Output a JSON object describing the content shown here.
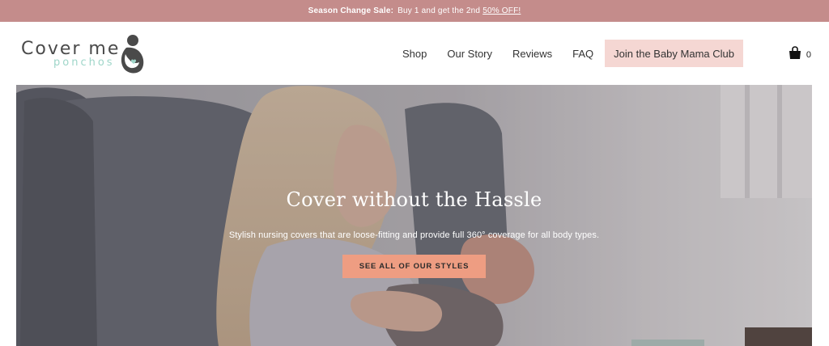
{
  "announcement": {
    "bold": "Season Change Sale:",
    "text": "Buy 1 and get the 2nd",
    "link": "50% OFF!"
  },
  "logo": {
    "main": "Cover me",
    "sub": "ponchos"
  },
  "nav": {
    "items": [
      {
        "label": "Shop"
      },
      {
        "label": "Our Story"
      },
      {
        "label": "Reviews"
      },
      {
        "label": "FAQ"
      }
    ],
    "club_button": "Join the Baby Mama Club",
    "cart_count": "0"
  },
  "hero": {
    "title": "Cover without the Hassle",
    "subtitle": "Stylish nursing covers that are loose-fitting and provide full 360° coverage for all body types.",
    "cta": "SEE ALL OF OUR STYLES"
  },
  "colors": {
    "announcement_bg": "#c48c8b",
    "club_button_bg": "#f5d7d3",
    "cta_bg": "#ee9d82",
    "logo_accent": "#9fd6c9"
  },
  "icons": {
    "cart": "shopping-bag-icon",
    "logo_mark": "mother-baby-logo-icon"
  }
}
